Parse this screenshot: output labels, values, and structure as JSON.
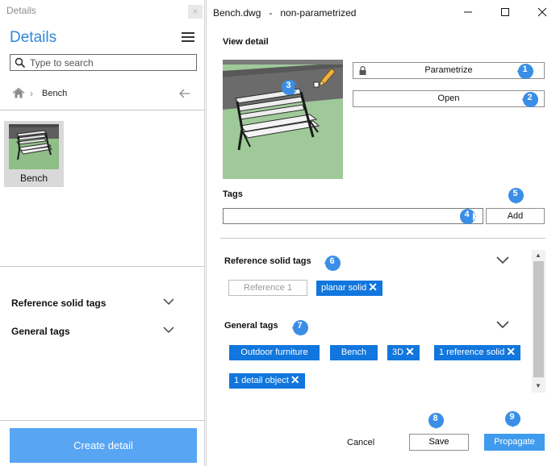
{
  "left_panel": {
    "window_title": "Details",
    "heading": "Details",
    "search": {
      "placeholder": "Type to search",
      "value": ""
    },
    "breadcrumb": {
      "current": "Bench"
    },
    "items": [
      {
        "label": "Bench"
      }
    ],
    "accordions": [
      {
        "label": "Reference solid tags"
      },
      {
        "label": "General tags"
      }
    ],
    "create_button": "Create detail"
  },
  "dialog": {
    "title": "Bench.dwg   -   non-parametrized",
    "view_detail_title": "View detail",
    "parametrize_button": "Parametrize",
    "open_button": "Open",
    "tags_title": "Tags",
    "tag_input": {
      "value": ""
    },
    "add_button": "Add",
    "reference_section": {
      "title": "Reference solid tags",
      "placeholder_chip": "Reference 1",
      "tags": [
        "planar solid"
      ]
    },
    "general_section": {
      "title": "General tags",
      "tags": [
        "Outdoor furniture",
        "Bench",
        "3D",
        "1 reference solid",
        "1 detail object"
      ]
    },
    "cancel_button": "Cancel",
    "save_button": "Save",
    "propagate_button": "Propagate"
  },
  "callouts": [
    "1",
    "2",
    "3",
    "4",
    "5",
    "6",
    "7",
    "8",
    "9"
  ],
  "colors": {
    "accent": "#2f88d8",
    "chip": "#1176dd",
    "callout": "#3a8ee6",
    "create_button": "#57a5f3",
    "propagate_button": "#3f9bee"
  }
}
